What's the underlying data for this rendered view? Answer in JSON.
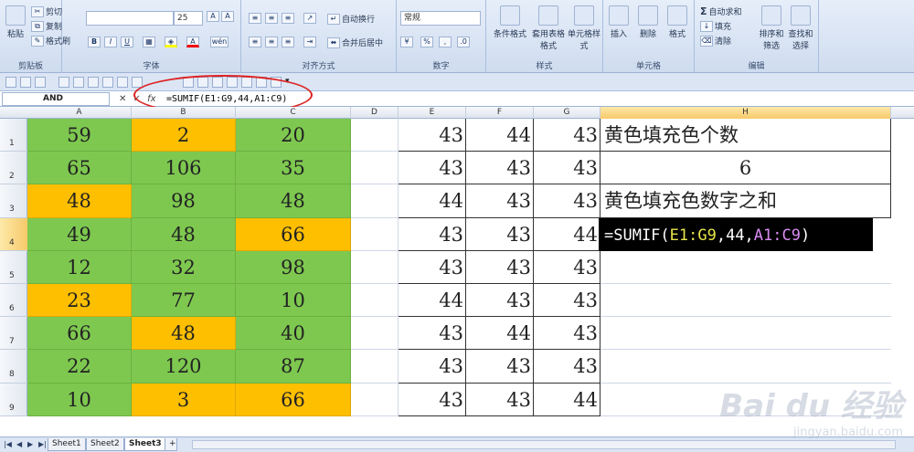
{
  "ribbon": {
    "clipboard": {
      "paste": "粘贴",
      "cut": "剪切",
      "copy": "复制",
      "format_painter": "格式刷",
      "label": "剪贴板"
    },
    "font": {
      "font_size": "25",
      "label": "字体",
      "bold": "B",
      "italic": "I",
      "underline": "U",
      "grow": "A",
      "shrink": "A",
      "phonetic": "wén"
    },
    "alignment": {
      "wrap": "自动换行",
      "merge": "合并后居中",
      "label": "对齐方式"
    },
    "number": {
      "format": "常规",
      "percent": "%",
      "comma": ",",
      "label": "数字"
    },
    "styles": {
      "conditional": "条件格式",
      "table_format": "套用表格格式",
      "cell_styles": "单元格样式",
      "label": "样式"
    },
    "cells": {
      "insert": "插入",
      "delete": "删除",
      "format": "格式",
      "label": "单元格"
    },
    "editing": {
      "autosum": "自动求和",
      "fill": "填充",
      "clear": "清除",
      "sort": "排序和筛选",
      "find": "查找和选择",
      "label": "编辑"
    }
  },
  "formula_bar": {
    "name_box": "AND",
    "fx": "fx",
    "formula": "=SUMIF(E1:G9,44,A1:C9)"
  },
  "columns": [
    "A",
    "B",
    "C",
    "D",
    "E",
    "F",
    "G",
    "H"
  ],
  "rows": [
    "1",
    "2",
    "3",
    "4",
    "5",
    "6",
    "7",
    "8",
    "9"
  ],
  "abc": [
    [
      {
        "v": "59",
        "c": "green"
      },
      {
        "v": "2",
        "c": "yellow"
      },
      {
        "v": "20",
        "c": "green"
      }
    ],
    [
      {
        "v": "65",
        "c": "green"
      },
      {
        "v": "106",
        "c": "green"
      },
      {
        "v": "35",
        "c": "green"
      }
    ],
    [
      {
        "v": "48",
        "c": "yellow"
      },
      {
        "v": "98",
        "c": "green"
      },
      {
        "v": "48",
        "c": "green"
      }
    ],
    [
      {
        "v": "49",
        "c": "green"
      },
      {
        "v": "48",
        "c": "green"
      },
      {
        "v": "66",
        "c": "yellow"
      }
    ],
    [
      {
        "v": "12",
        "c": "green"
      },
      {
        "v": "32",
        "c": "green"
      },
      {
        "v": "98",
        "c": "green"
      }
    ],
    [
      {
        "v": "23",
        "c": "yellow"
      },
      {
        "v": "77",
        "c": "green"
      },
      {
        "v": "10",
        "c": "green"
      }
    ],
    [
      {
        "v": "66",
        "c": "green"
      },
      {
        "v": "48",
        "c": "yellow"
      },
      {
        "v": "40",
        "c": "green"
      }
    ],
    [
      {
        "v": "22",
        "c": "green"
      },
      {
        "v": "120",
        "c": "green"
      },
      {
        "v": "87",
        "c": "green"
      }
    ],
    [
      {
        "v": "10",
        "c": "green"
      },
      {
        "v": "3",
        "c": "yellow"
      },
      {
        "v": "66",
        "c": "yellow"
      }
    ]
  ],
  "efg": [
    [
      "43",
      "44",
      "43"
    ],
    [
      "43",
      "43",
      "43"
    ],
    [
      "44",
      "43",
      "43"
    ],
    [
      "43",
      "43",
      "44"
    ],
    [
      "43",
      "43",
      "43"
    ],
    [
      "44",
      "43",
      "43"
    ],
    [
      "43",
      "44",
      "43"
    ],
    [
      "43",
      "43",
      "43"
    ],
    [
      "43",
      "43",
      "44"
    ]
  ],
  "h": {
    "h1": "黄色填充色个数",
    "h2": "6",
    "h3": "黄色填充色数字之和",
    "h4_parts": [
      "=SUMIF(",
      "E1:G9",
      ",44,",
      "A1:C9",
      ")"
    ]
  },
  "sheets": [
    "Sheet1",
    "Sheet2",
    "Sheet3"
  ],
  "watermark": {
    "brand": "Bai du 经验",
    "url": "jingyan.baidu.com"
  },
  "colors": {
    "green": "#7ec850",
    "yellow": "#fdbf00",
    "formula_ref1": "#e9e44a",
    "formula_ref2": "#d88cf0"
  }
}
